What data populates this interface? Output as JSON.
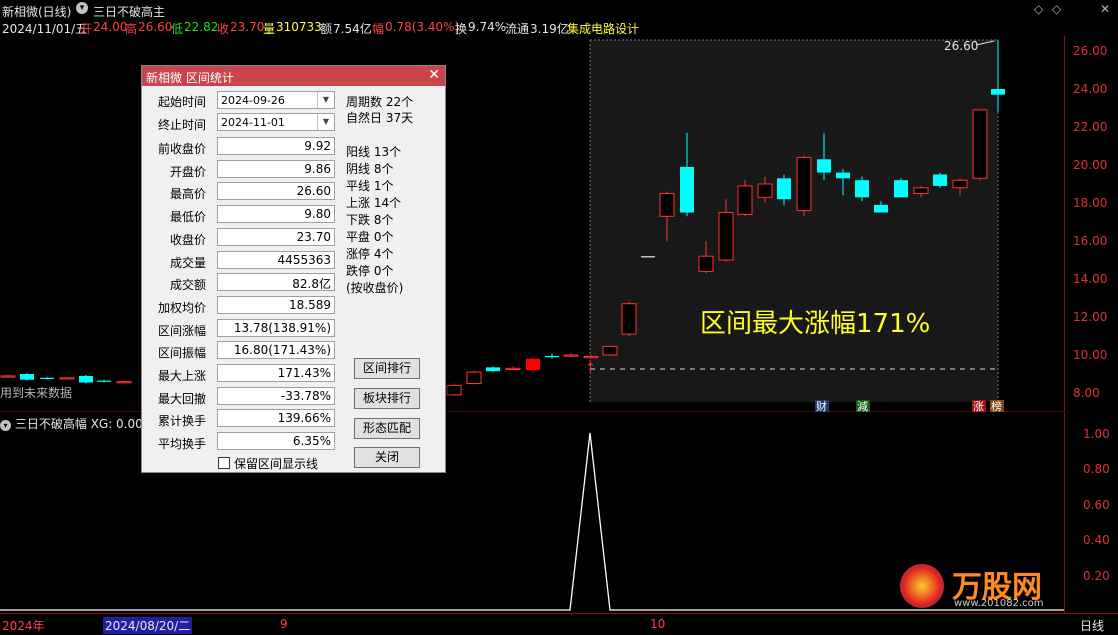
{
  "header": {
    "name": "新相微",
    "period": "(日线)",
    "formula": "三日不破高主",
    "date": "2024/11/01/五",
    "open_lbl": "开",
    "open": "24.00",
    "high_lbl": "高",
    "high": "26.60",
    "low_lbl": "低",
    "low": "22.82",
    "close_lbl": "收",
    "close": "23.70",
    "vol_lbl": "量",
    "vol": "310733",
    "amt_lbl": "额",
    "amt": "7.54亿",
    "chg_lbl": "幅",
    "chg": "0.78(3.40%)",
    "turn_lbl": "换",
    "turn": "9.74%",
    "float_lbl": "流通",
    "float": "3.19亿",
    "sector": "集成电路设计"
  },
  "main_chart": {
    "y_ticks": [
      "26.00",
      "24.00",
      "22.00",
      "20.00",
      "18.00",
      "16.00",
      "14.00",
      "12.00",
      "10.00",
      "8.00"
    ],
    "peak_label": "26.60",
    "future_data_note": "用到未来数据",
    "overlay_text": "区间最大涨幅171%",
    "markers": [
      "财",
      "減",
      "涨",
      "榜"
    ],
    "colors": {
      "up": "#ff3030",
      "down": "#00ffff",
      "axis": "#e03030",
      "mark_yellow": "#ffff20"
    }
  },
  "sub_chart": {
    "title": "三日不破高幅",
    "xg_label": "XG: 0.00",
    "y_ticks": [
      "1.00",
      "0.80",
      "0.60",
      "0.40",
      "0.20"
    ]
  },
  "x_axis": {
    "labels": [
      "2024年",
      "2024/08/20/二",
      "9",
      "10",
      "日线"
    ]
  },
  "dialog": {
    "title": "新相微  区间统计",
    "start_label": "起始时间",
    "start_value": "2024-09-26",
    "end_label": "终止时间",
    "end_value": "2024-11-01",
    "fields": [
      {
        "label": "前收盘价",
        "value": "9.92"
      },
      {
        "label": "开盘价",
        "value": "9.86"
      },
      {
        "label": "最高价",
        "value": "26.60"
      },
      {
        "label": "最低价",
        "value": "9.80"
      },
      {
        "label": "收盘价",
        "value": "23.70"
      },
      {
        "label": "成交量",
        "value": "4455363"
      },
      {
        "label": "成交额",
        "value": "82.8亿"
      },
      {
        "label": "加权均价",
        "value": "18.589"
      },
      {
        "label": "区间涨幅",
        "value": "13.78(138.91%)"
      },
      {
        "label": "区间振幅",
        "value": "16.80(171.43%)"
      },
      {
        "label": "最大上涨",
        "value": "171.43%"
      },
      {
        "label": "最大回撤",
        "value": "-33.78%"
      },
      {
        "label": "累计换手",
        "value": "139.66%"
      },
      {
        "label": "平均换手",
        "value": "6.35%"
      }
    ],
    "stats": [
      "周期数 22个",
      "自然日 37天",
      "阳线 13个",
      "阴线 8个",
      "平线 1个",
      "上涨 14个",
      "下跌 8个",
      "平盘 0个",
      "涨停 4个",
      "跌停 0个",
      "(按收盘价)"
    ],
    "buttons": [
      "区间排行",
      "板块排行",
      "形态匹配",
      "关闭"
    ],
    "checkbox_label": "保留区间显示线"
  },
  "watermark": {
    "brand": "万股网",
    "url": "www.201082.com"
  }
}
